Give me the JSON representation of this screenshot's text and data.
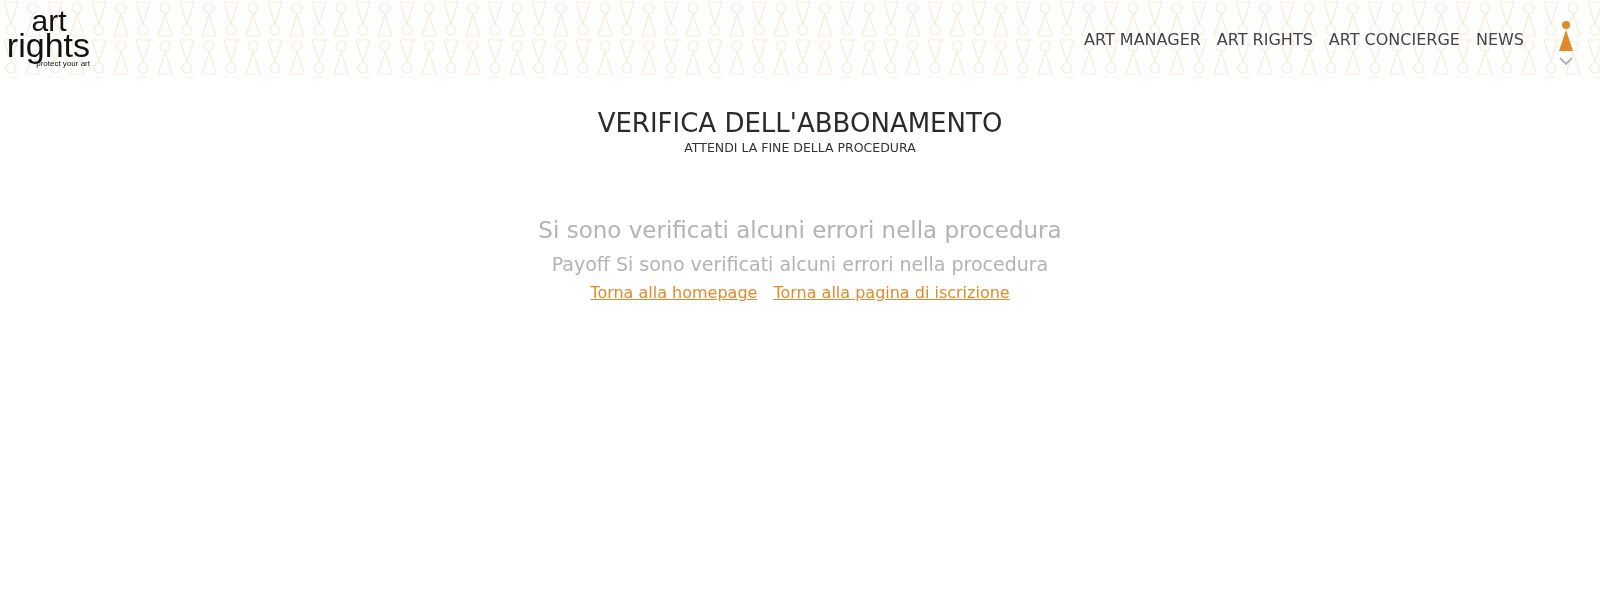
{
  "logo": {
    "line_1": "art",
    "line_2": "rights",
    "tagline": "protect your art"
  },
  "nav": [
    {
      "label": "ART MANAGER"
    },
    {
      "label": "ART RIGHTS"
    },
    {
      "label": "ART CONCIERGE"
    },
    {
      "label": "NEWS"
    }
  ],
  "heading": {
    "title": "VERIFICA DELL'ABBONAMENTO",
    "subtitle": "ATTENDI LA FINE DELLA PROCEDURA"
  },
  "message": {
    "error": "Si sono verificati alcuni errori nella procedura",
    "payoff": "Payoff Si sono verificati alcuni errori nella procedura"
  },
  "links": [
    {
      "label": "Torna alla homepage"
    },
    {
      "label": "Torna alla pagina di iscrizione"
    }
  ]
}
